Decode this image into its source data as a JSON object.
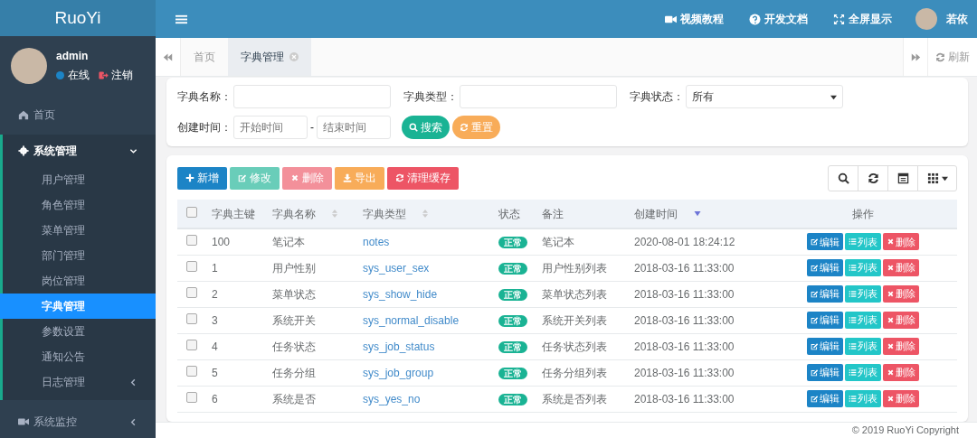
{
  "brand": "RuoYi",
  "user": {
    "name": "admin",
    "status": "在线",
    "logout": "注销"
  },
  "menu": [
    {
      "label": "首页"
    },
    {
      "label": "系统管理",
      "expanded": true,
      "children": [
        {
          "label": "用户管理",
          "selected": false
        },
        {
          "label": "角色管理",
          "selected": false
        },
        {
          "label": "菜单管理",
          "selected": false
        },
        {
          "label": "部门管理",
          "selected": false
        },
        {
          "label": "岗位管理",
          "selected": false
        },
        {
          "label": "字典管理",
          "selected": true
        },
        {
          "label": "参数设置",
          "selected": false
        },
        {
          "label": "通知公告",
          "selected": false
        },
        {
          "label": "日志管理",
          "selected": false,
          "expanded": false
        }
      ]
    },
    {
      "label": "系统监控",
      "expanded": false
    }
  ],
  "topnav": [
    {
      "label": "视频教程"
    },
    {
      "label": "开发文档"
    },
    {
      "label": "全屏显示"
    }
  ],
  "top_user": "若依",
  "tabs": [
    {
      "label": "首页",
      "selected": false,
      "closable": false
    },
    {
      "label": "字典管理",
      "selected": true,
      "closable": true
    }
  ],
  "refresh": "刷新",
  "search": {
    "fields": [
      {
        "label": "字典名称：",
        "kind": "text"
      },
      {
        "label": "字典类型：",
        "kind": "text"
      },
      {
        "label": "字典状态：",
        "kind": "select",
        "value": "所有"
      }
    ],
    "date": {
      "label": "创建时间：",
      "start_placeholder": "开始时间",
      "separator": "-",
      "end_placeholder": "结束时间"
    },
    "buttons": [
      {
        "label": "搜索",
        "kind": "search"
      },
      {
        "label": "重置",
        "kind": "reset"
      }
    ]
  },
  "toolbar": [
    {
      "label": "新增",
      "kind": "add",
      "disabled": false
    },
    {
      "label": "修改",
      "kind": "edit",
      "disabled": true
    },
    {
      "label": "删除",
      "kind": "remove",
      "disabled": true
    },
    {
      "label": "导出",
      "kind": "export",
      "disabled": false
    },
    {
      "label": "清理缓存",
      "kind": "clear",
      "disabled": false
    }
  ],
  "table": {
    "all_checked": false,
    "columns": [
      {
        "label": "字典主键",
        "sortable": false
      },
      {
        "label": "字典名称",
        "sortable": true,
        "sorted": false
      },
      {
        "label": "字典类型",
        "sortable": true,
        "sorted": false
      },
      {
        "label": "状态",
        "sortable": false
      },
      {
        "label": "备注",
        "sortable": false
      },
      {
        "label": "创建时间",
        "sortable": true,
        "sorted": true
      },
      {
        "label": "操作",
        "sortable": false
      }
    ],
    "rows": [
      {
        "checked": false,
        "id": "100",
        "name": "笔记本",
        "type": "notes",
        "status": "正常",
        "remark": "笔记本",
        "time": "2020-08-01 18:24:12",
        "actions": [
          "编辑",
          "列表",
          "删除"
        ]
      },
      {
        "checked": false,
        "id": "1",
        "name": "用户性别",
        "type": "sys_user_sex",
        "status": "正常",
        "remark": "用户性别列表",
        "time": "2018-03-16 11:33:00",
        "actions": [
          "编辑",
          "列表",
          "删除"
        ]
      },
      {
        "checked": false,
        "id": "2",
        "name": "菜单状态",
        "type": "sys_show_hide",
        "status": "正常",
        "remark": "菜单状态列表",
        "time": "2018-03-16 11:33:00",
        "actions": [
          "编辑",
          "列表",
          "删除"
        ]
      },
      {
        "checked": false,
        "id": "3",
        "name": "系统开关",
        "type": "sys_normal_disable",
        "status": "正常",
        "remark": "系统开关列表",
        "time": "2018-03-16 11:33:00",
        "actions": [
          "编辑",
          "列表",
          "删除"
        ]
      },
      {
        "checked": false,
        "id": "4",
        "name": "任务状态",
        "type": "sys_job_status",
        "status": "正常",
        "remark": "任务状态列表",
        "time": "2018-03-16 11:33:00",
        "actions": [
          "编辑",
          "列表",
          "删除"
        ]
      },
      {
        "checked": false,
        "id": "5",
        "name": "任务分组",
        "type": "sys_job_group",
        "status": "正常",
        "remark": "任务分组列表",
        "time": "2018-03-16 11:33:00",
        "actions": [
          "编辑",
          "列表",
          "删除"
        ]
      },
      {
        "checked": false,
        "id": "6",
        "name": "系统是否",
        "type": "sys_yes_no",
        "status": "正常",
        "remark": "系统是否列表",
        "time": "2018-03-16 11:33:00",
        "actions": [
          "编辑",
          "列表",
          "删除"
        ]
      }
    ]
  },
  "footer": "© 2019 RuoYi Copyright"
}
